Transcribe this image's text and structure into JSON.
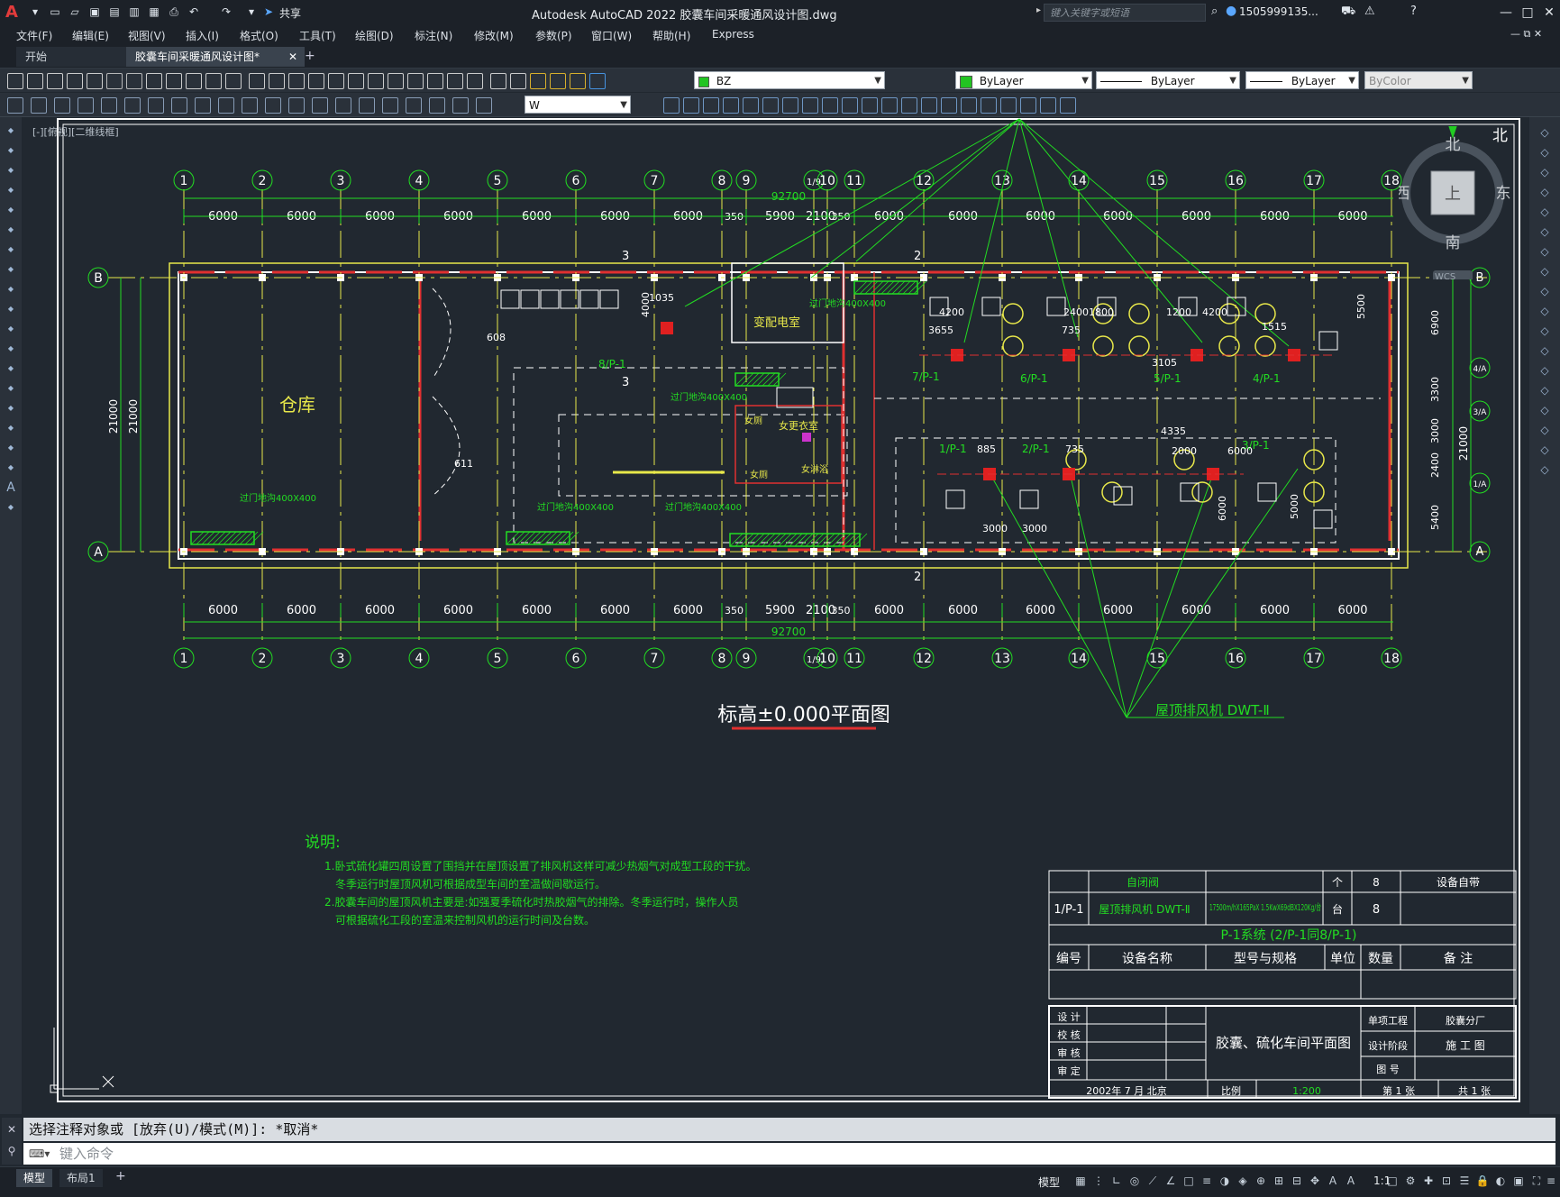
{
  "app": {
    "title": "Autodesk AutoCAD 2022    胶囊车间采暖通风设计图.dwg",
    "search_placeholder": "键入关键字或短语",
    "user": "1505999135...",
    "share_label": "共享"
  },
  "menu": [
    "文件(F)",
    "编辑(E)",
    "视图(V)",
    "插入(I)",
    "格式(O)",
    "工具(T)",
    "绘图(D)",
    "标注(N)",
    "修改(M)",
    "参数(P)",
    "窗口(W)",
    "帮助(H)",
    "Express"
  ],
  "tabs": {
    "start": "开始",
    "document": "胶囊车间采暖通风设计图*"
  },
  "toolbar": {
    "layer": "BZ",
    "color": "ByLayer",
    "linetype": "ByLayer",
    "lineweight": "ByLayer",
    "plotstyle": "ByColor",
    "textstyle": "W"
  },
  "viewport_label": "[-][俯视][二维线框]",
  "viewcube": {
    "north": "北",
    "south": "南",
    "east": "东",
    "west": "西",
    "top": "上",
    "wcs": "WCS"
  },
  "drawing": {
    "plan_title": "标高±0.000平面图",
    "axes_top": [
      "1",
      "2",
      "3",
      "4",
      "5",
      "6",
      "7",
      "8",
      "9",
      "1/9",
      "10",
      "11",
      "12",
      "13",
      "14",
      "15",
      "16",
      "17",
      "18"
    ],
    "dim_top": [
      "6000",
      "6000",
      "6000",
      "6000",
      "6000",
      "6000",
      "6000",
      "350",
      "5900",
      "2100",
      "350",
      "6000",
      "6000",
      "6000",
      "6000",
      "6000",
      "6000",
      "6000"
    ],
    "total_length": "92700",
    "row_axes": [
      "B",
      "A"
    ],
    "right_axes": [
      "B",
      "4/A",
      "3/A",
      "1/A",
      "A"
    ],
    "right_dims": [
      "6900",
      "3300",
      "3000",
      "2400",
      "5400"
    ],
    "width_dim": "21000",
    "room_labels": {
      "warehouse": "仓库",
      "substation": "变配电室",
      "women_locker": "女更衣室",
      "toilet": "女厕",
      "women_wash": "女厕",
      "women_shower": "女淋浴"
    },
    "ducts": [
      "过门地沟400X400",
      "过门地沟400X400",
      "过门地沟400X400",
      "过门地沟400X400",
      "过门地沟400X400",
      "过门地沟400X400"
    ],
    "fan_tags": [
      "7/P-1",
      "6/P-1",
      "5/P-1",
      "4/P-1",
      "1/P-1",
      "2/P-1",
      "3/P-1",
      "8/P-1"
    ],
    "misc_dims": [
      "4200",
      "3655",
      "2400",
      "1800",
      "735",
      "1200",
      "4200",
      "1515",
      "3105",
      "5500",
      "4335",
      "885",
      "735",
      "2000",
      "6000",
      "3000",
      "3000",
      "6000",
      "5000",
      "1035",
      "608",
      "611",
      "4000"
    ],
    "roof_fan_label": "屋顶排风机 DWT-Ⅱ",
    "section_marks": [
      "3",
      "2",
      "3",
      "2"
    ]
  },
  "notes": {
    "title": "说明:",
    "lines": [
      "1.卧式硫化罐四周设置了围挡并在屋顶设置了排风机这样可减少热烟气对成型工段的干扰。",
      "冬季运行时屋顶风机可根据成型车间的室温做间歇运行。",
      "2.胶囊车间的屋顶风机主要是:如强夏季硫化时热胶烟气的排除。冬季运行时，操作人员",
      "可根据硫化工段的室温来控制风机的运行时间及台数。"
    ]
  },
  "equipment_table": {
    "rows": [
      {
        "no": "",
        "name": "自闭阀",
        "spec": "",
        "unit": "个",
        "qty": "8",
        "note": "设备自带"
      },
      {
        "no": "1/P-1",
        "name": "屋顶排风机  DWT-Ⅱ",
        "spec": "17500m/hX165PaX 1.5KwX69dBX120Kg/台",
        "unit": "台",
        "qty": "8",
        "note": ""
      }
    ],
    "system_row": "P-1系统    (2/P-1同8/P-1)",
    "headers": [
      "编号",
      "设备名称",
      "型号与规格",
      "单位",
      "数量",
      "备    注"
    ]
  },
  "title_block": {
    "roles": [
      "设 计",
      "校 核",
      "审 核",
      "审 定"
    ],
    "drawing_name": "胶囊、硫化车间平面图",
    "fields": [
      [
        "单项工程",
        "胶囊分厂"
      ],
      [
        "设计阶段",
        "施  工  图"
      ],
      [
        "图  号",
        ""
      ]
    ],
    "date_row": "2002年 7 月   北京",
    "scale_label": "比例",
    "scale": "1:200",
    "sheet": "第 1 张",
    "total": "共 1 张"
  },
  "command": {
    "history": "选择注释对象或 [放弃(U)/模式(M)]: *取消*",
    "placeholder": "键入命令"
  },
  "layout_tabs": [
    "模型",
    "布局1"
  ],
  "status": {
    "model": "模型",
    "scale": "1:1"
  }
}
